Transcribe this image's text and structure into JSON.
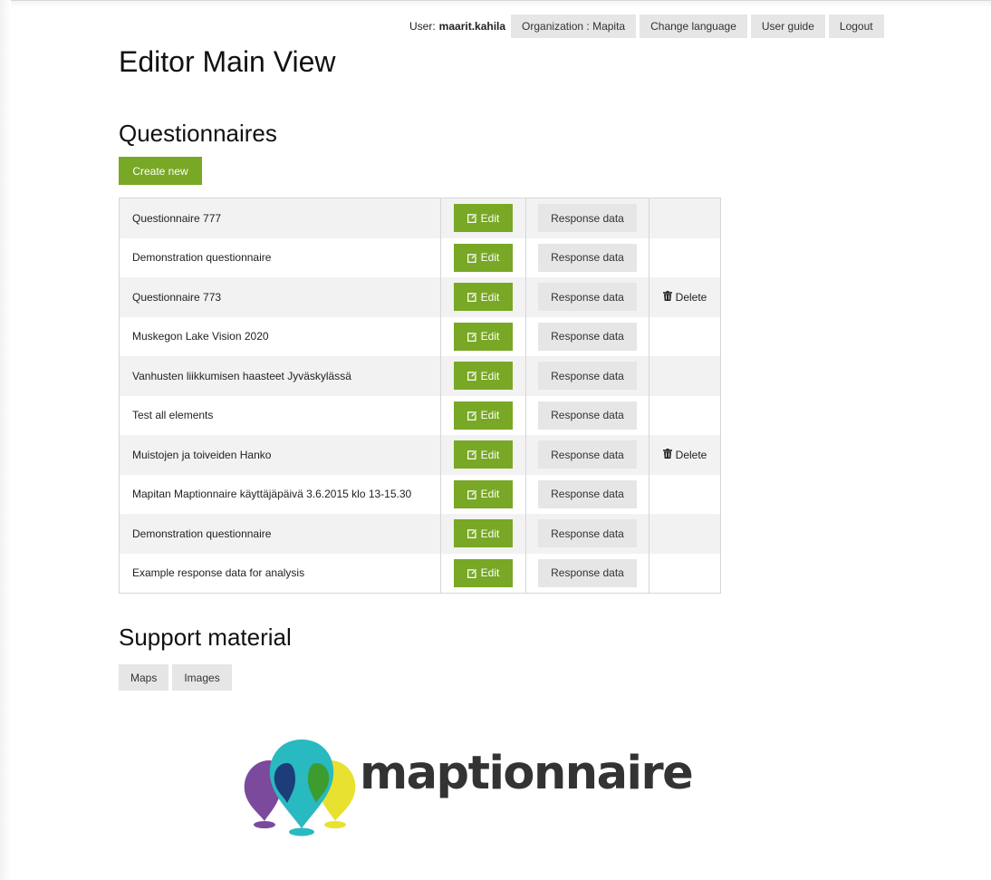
{
  "topbar": {
    "user_label": "User:",
    "user_name": "maarit.kahila",
    "organization": "Organization : Mapita",
    "change_language": "Change language",
    "user_guide": "User guide",
    "logout": "Logout"
  },
  "page_title": "Editor Main View",
  "questionnaires": {
    "heading": "Questionnaires",
    "create_new": "Create new",
    "edit_label": "Edit",
    "response_label": "Response data",
    "delete_label": "Delete",
    "rows": [
      {
        "name": "Questionnaire 777",
        "delete": ""
      },
      {
        "name": "Demonstration questionnaire",
        "delete": ""
      },
      {
        "name": "Questionnaire 773",
        "delete": "Delete"
      },
      {
        "name": "Muskegon Lake Vision 2020",
        "delete": ""
      },
      {
        "name": "Vanhusten liikkumisen haasteet Jyväskylässä",
        "delete": ""
      },
      {
        "name": "Test all elements",
        "delete": ""
      },
      {
        "name": "Muistojen ja toiveiden Hanko",
        "delete": "Delete"
      },
      {
        "name": "Mapitan Maptionnaire käyttäjäpäivä 3.6.2015 klo 13-15.30",
        "delete": ""
      },
      {
        "name": "Demonstration questionnaire",
        "delete": ""
      },
      {
        "name": "Example response data for analysis",
        "delete": ""
      }
    ]
  },
  "support": {
    "heading": "Support material",
    "maps": "Maps",
    "images": "Images"
  },
  "logo": {
    "text": "maptionnaire",
    "colors": {
      "purple": "#7b4a9c",
      "navy": "#1c3d78",
      "teal": "#29b9c0",
      "green": "#3c9c30",
      "yellow": "#e9e12f"
    }
  },
  "colors": {
    "accent": "#78a825",
    "button_gray": "#e6e6e6"
  },
  "icons": {
    "edit": "pencil-square-icon",
    "delete": "trash-icon"
  }
}
